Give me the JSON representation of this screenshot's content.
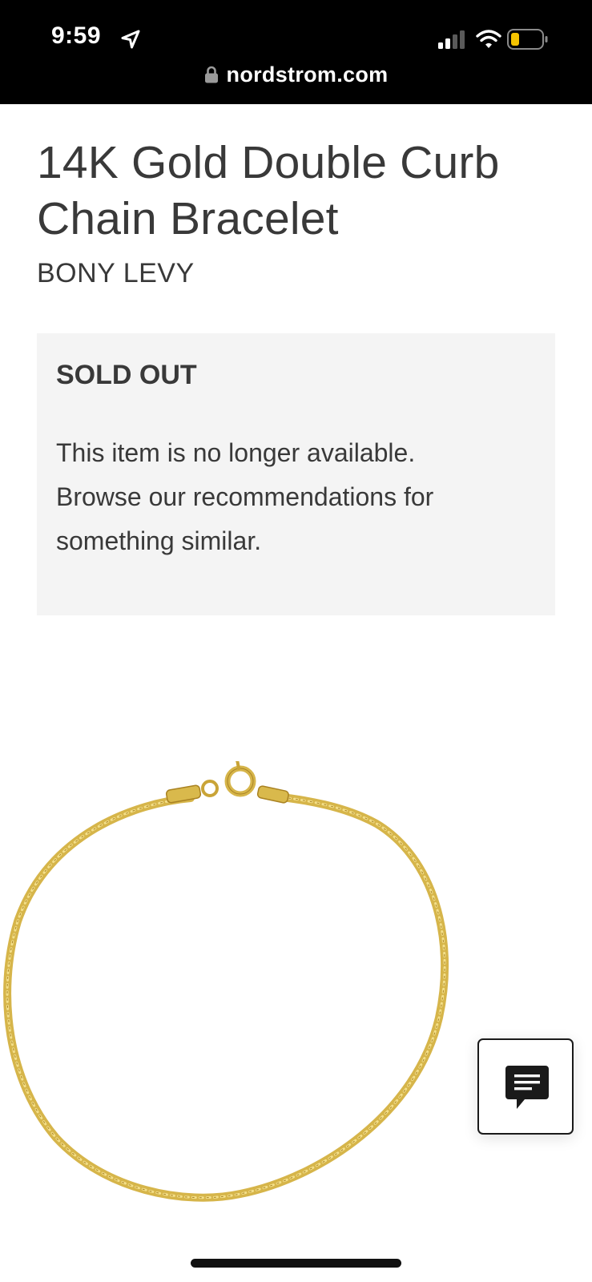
{
  "status_bar": {
    "time": "9:59",
    "icons": [
      "location-arrow-icon",
      "cellular-signal-icon",
      "wifi-icon",
      "battery-low-icon"
    ],
    "battery_color": "#f5c400"
  },
  "browser": {
    "url": "nordstrom.com",
    "lock_icon": "lock-icon"
  },
  "product": {
    "title": "14K Gold Double Curb Chain Bracelet",
    "brand": "BONY LEVY",
    "image": {
      "subject": "gold-chain-bracelet",
      "color": "#d6b54a"
    }
  },
  "availability": {
    "heading": "SOLD OUT",
    "message": "This item is no longer available. Browse our recommendations for something similar.",
    "background": "#f4f4f4"
  },
  "chat": {
    "icon": "chat-bubble-icon"
  },
  "colors": {
    "text": "#393939",
    "topbar": "#000000"
  }
}
